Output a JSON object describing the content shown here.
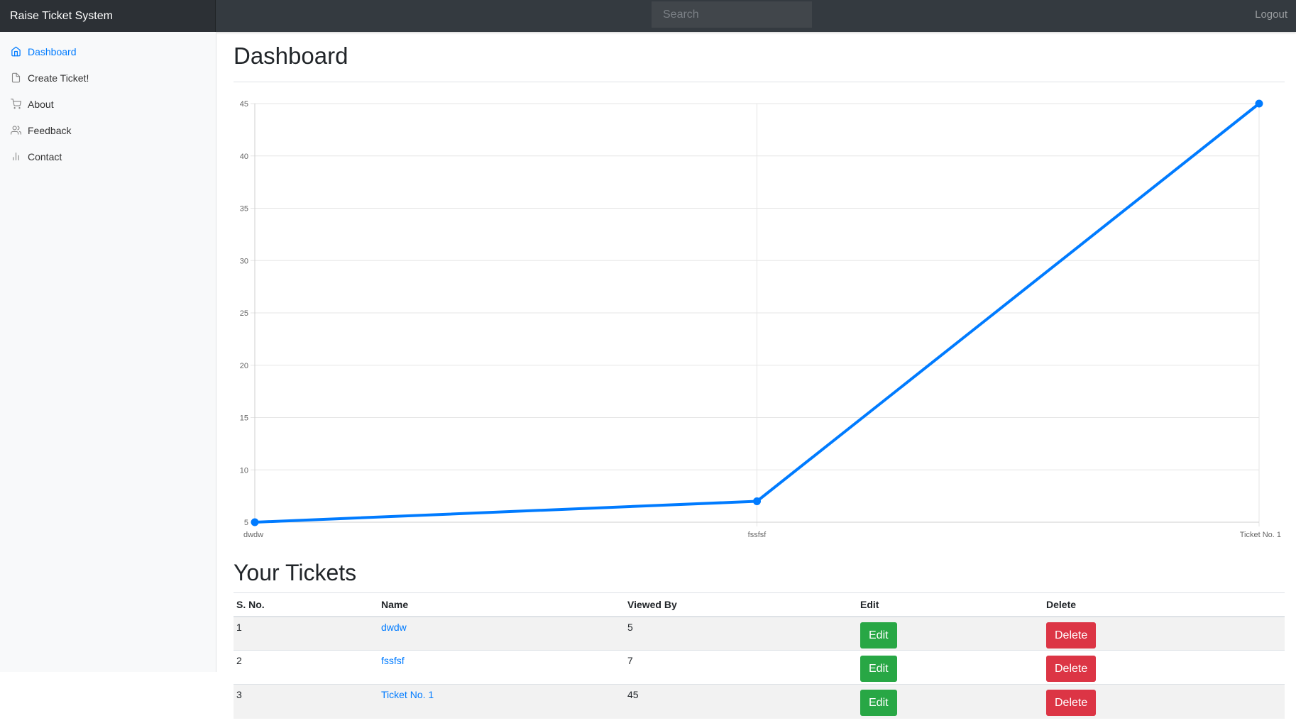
{
  "app": {
    "brand": "Raise Ticket System"
  },
  "header": {
    "search_placeholder": "Search",
    "logout_label": "Logout"
  },
  "sidebar": {
    "items": [
      {
        "label": "Dashboard",
        "icon": "home-icon",
        "active": true
      },
      {
        "label": "Create Ticket!",
        "icon": "file-icon",
        "active": false
      },
      {
        "label": "About",
        "icon": "cart-icon",
        "active": false
      },
      {
        "label": "Feedback",
        "icon": "users-icon",
        "active": false
      },
      {
        "label": "Contact",
        "icon": "bar-chart-icon",
        "active": false
      }
    ]
  },
  "main": {
    "title": "Dashboard",
    "tickets_title": "Your Tickets"
  },
  "colors": {
    "accent": "#007bff",
    "edit": "#28a745",
    "delete": "#dc3545"
  },
  "chart_data": {
    "type": "line",
    "categories": [
      "dwdw",
      "fssfsf",
      "Ticket No. 1"
    ],
    "series": [
      {
        "values": [
          5,
          7,
          45
        ]
      }
    ],
    "ylim": [
      5,
      45
    ],
    "yticks": [
      5,
      10,
      15,
      20,
      25,
      30,
      35,
      40,
      45
    ],
    "grid": true,
    "color": "#007bff"
  },
  "table": {
    "headers": [
      "S. No.",
      "Name",
      "Viewed By",
      "Edit",
      "Delete"
    ],
    "rows": [
      {
        "sno": "1",
        "name": "dwdw",
        "viewed": "5",
        "edit": "Edit",
        "delete": "Delete"
      },
      {
        "sno": "2",
        "name": "fssfsf",
        "viewed": "7",
        "edit": "Edit",
        "delete": "Delete"
      },
      {
        "sno": "3",
        "name": "Ticket No. 1",
        "viewed": "45",
        "edit": "Edit",
        "delete": "Delete"
      }
    ]
  }
}
